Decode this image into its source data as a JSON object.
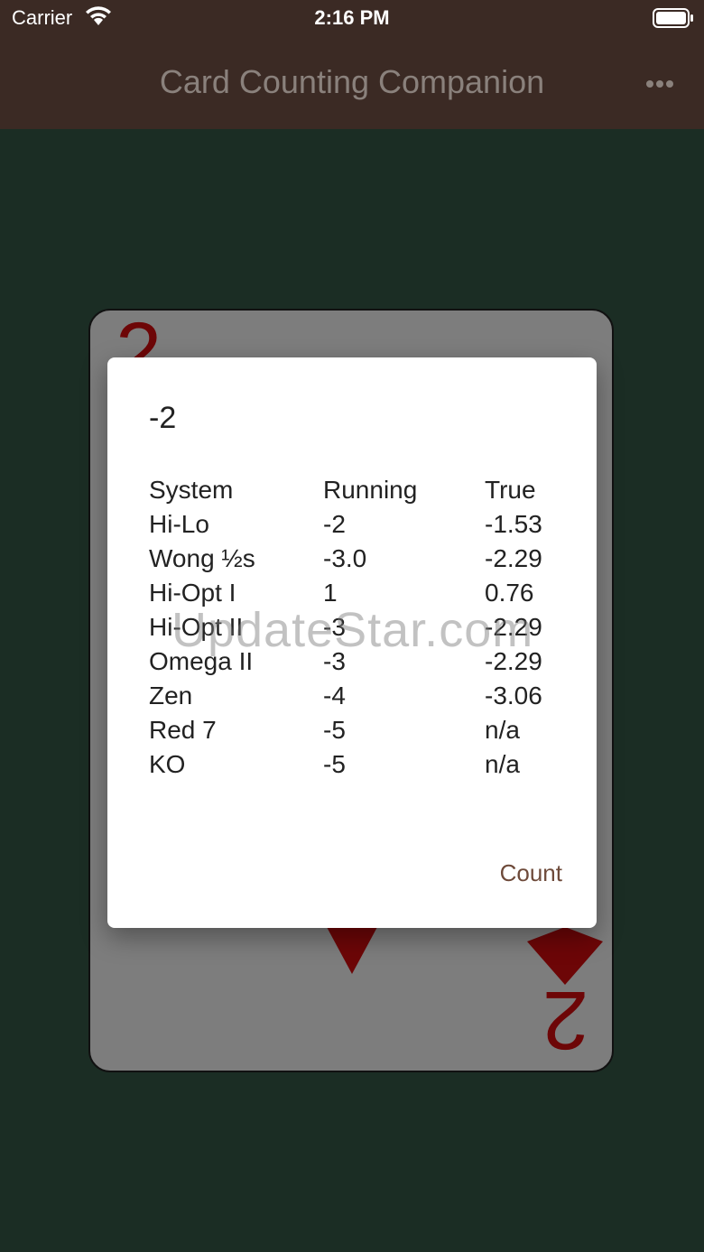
{
  "status_bar": {
    "carrier": "Carrier",
    "time": "2:16 PM"
  },
  "nav": {
    "title": "Card Counting Companion",
    "menu_icon": "more-icon"
  },
  "card": {
    "rank": "2",
    "suit": "diamonds",
    "color": "#6d0607"
  },
  "dialog": {
    "title": "-2",
    "headers": [
      "System",
      "Running",
      "True"
    ],
    "rows": [
      [
        "Hi-Lo",
        "-2",
        "-1.53"
      ],
      [
        "Wong ½s",
        "-3.0",
        "-2.29"
      ],
      [
        "Hi-Opt I",
        "1",
        "0.76"
      ],
      [
        "Hi-Opt II",
        "-3",
        "-2.29"
      ],
      [
        "Omega II",
        "-3",
        "-2.29"
      ],
      [
        "Zen",
        "-4",
        "-3.06"
      ],
      [
        "Red 7",
        "-5",
        "n/a"
      ],
      [
        "KO",
        "-5",
        "n/a"
      ]
    ],
    "button": "Count"
  },
  "watermark": "UpdateStar.com",
  "colors": {
    "nav_bg": "#3b2a24",
    "felt_bg": "#1b2d24",
    "accent": "#6e4a3a"
  }
}
